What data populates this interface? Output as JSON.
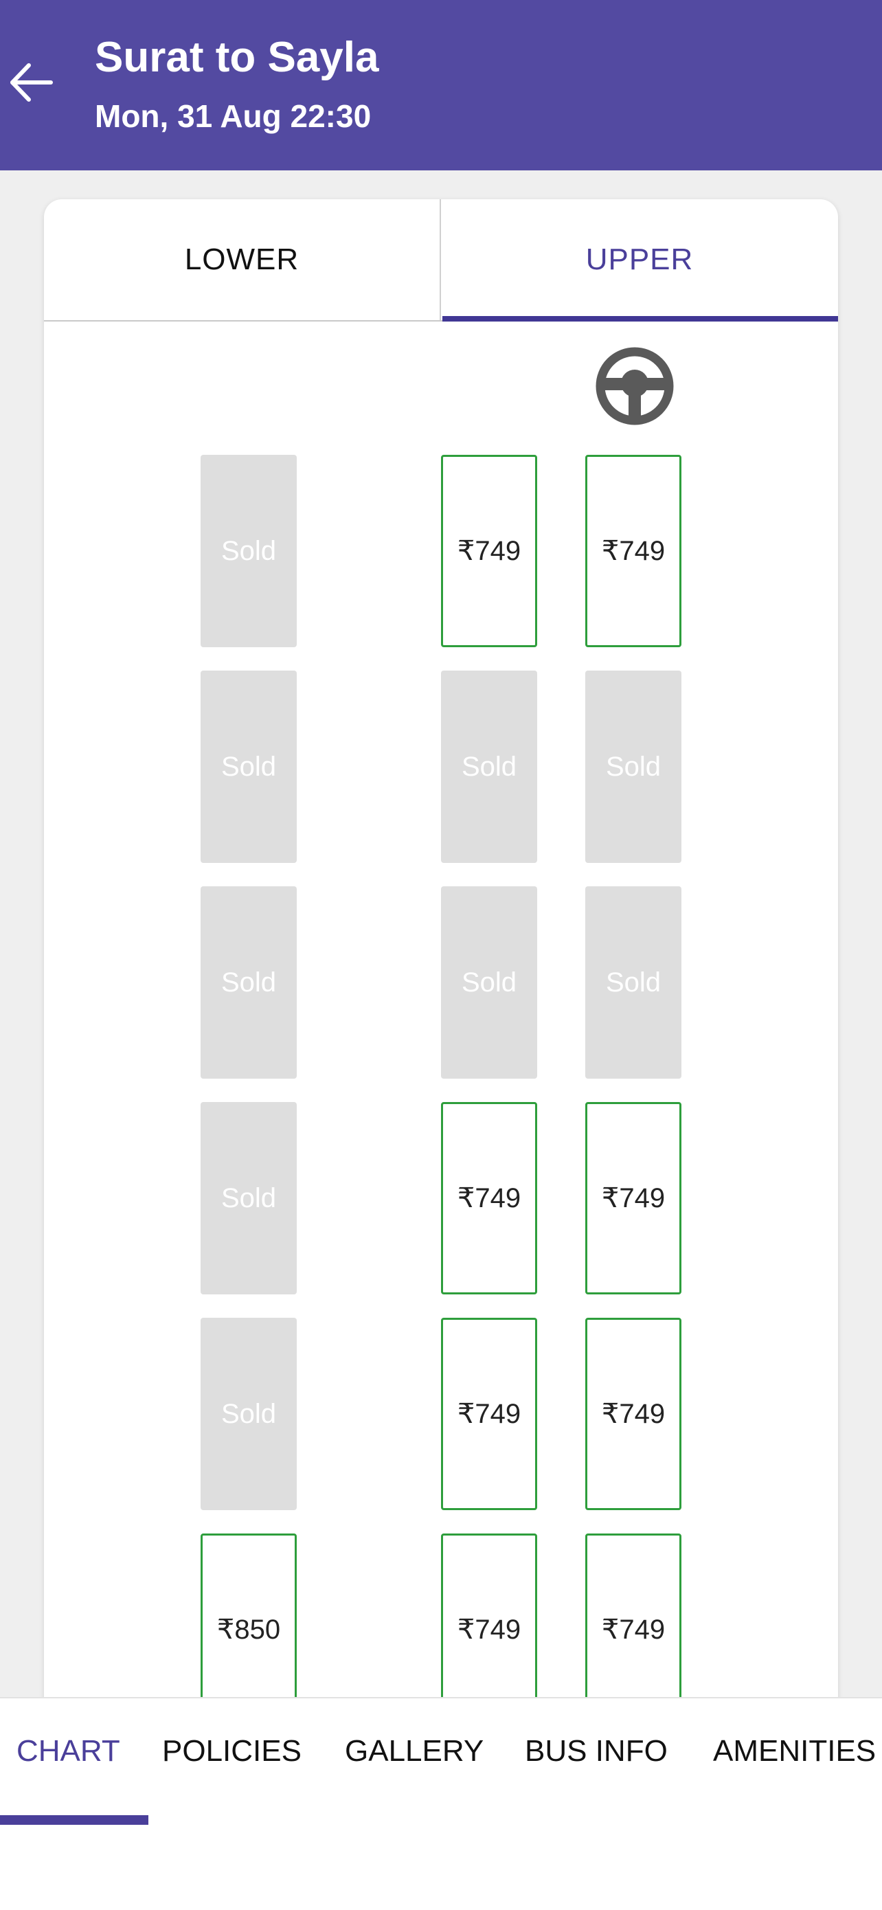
{
  "header": {
    "title": "Surat to Sayla",
    "subtitle": "Mon, 31 Aug 22:30",
    "back_icon": "arrow-left-icon",
    "background_color": "#534aa1"
  },
  "deck_tabs": [
    {
      "label": "LOWER",
      "selected": false
    },
    {
      "label": "UPPER",
      "selected": true
    }
  ],
  "steering_icon": "steering-wheel-icon",
  "seats": {
    "left_column": [
      "Sold",
      "Sold",
      "Sold",
      "Sold",
      "Sold",
      "₹850"
    ],
    "middle_column": [
      "₹749",
      "Sold",
      "Sold",
      "₹749",
      "₹749",
      "₹749"
    ],
    "right_column": [
      "₹749",
      "Sold",
      "Sold",
      "₹749",
      "₹749",
      "₹749"
    ]
  },
  "colors": {
    "accent": "#4a3f9a",
    "available_border": "#2e9e3c",
    "sold_fill": "#dedede"
  },
  "info_tabs": [
    {
      "label": "CHART",
      "selected": true
    },
    {
      "label": "POLICIES",
      "selected": false
    },
    {
      "label": "GALLERY",
      "selected": false
    },
    {
      "label": "BUS INFO",
      "selected": false
    },
    {
      "label": "AMENITIES",
      "selected": false
    }
  ]
}
